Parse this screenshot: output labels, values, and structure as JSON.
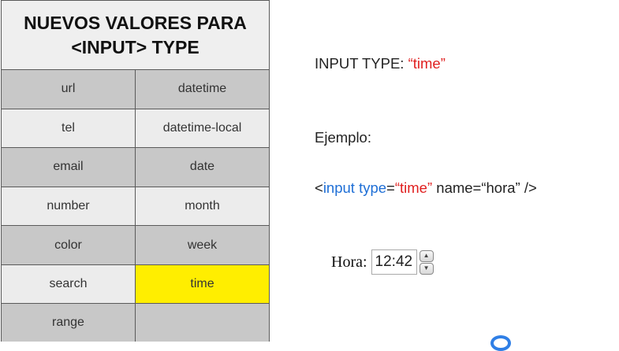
{
  "table": {
    "header_line1": "NUEVOS VALORES PARA",
    "header_line2": "<INPUT> TYPE",
    "rows": [
      [
        "url",
        "datetime"
      ],
      [
        "tel",
        "datetime-local"
      ],
      [
        "email",
        "date"
      ],
      [
        "number",
        "month"
      ],
      [
        "color",
        "week"
      ],
      [
        "search",
        "time"
      ],
      [
        "range",
        ""
      ]
    ],
    "highlight_cell": "time",
    "highlight_color": "#ffee00"
  },
  "right": {
    "title_prefix": "INPUT TYPE: ",
    "title_value": "“time”",
    "example_label": "Ejemplo:",
    "code": {
      "lt": "<",
      "tag": "input",
      "space1": " ",
      "attr": "type",
      "eq": "=",
      "value": "“time”",
      "rest": "  name=“hora” />"
    }
  },
  "widget": {
    "label": "Hora:",
    "value": "12:42",
    "up_icon": "▲",
    "down_icon": "▼"
  },
  "colors": {
    "keyword_red": "#e02020",
    "keyword_blue": "#1f6fd6"
  }
}
